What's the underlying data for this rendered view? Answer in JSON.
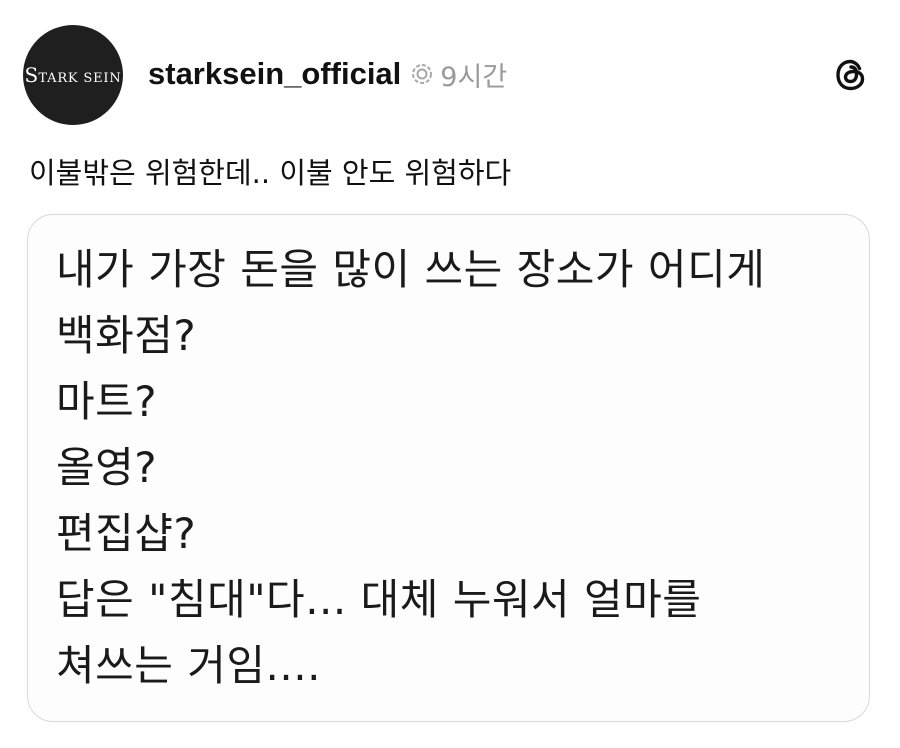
{
  "post": {
    "avatar": {
      "brand_big": "S",
      "brand_tark": "TARK",
      "brand_sein": "SEIN"
    },
    "username": "starksein_official",
    "verified_icon": "verified-badge-icon",
    "time": "9시간",
    "app_icon": "threads-logo-icon",
    "caption": "이불밖은 위험한데.. 이불 안도 위험하다",
    "image_card": {
      "lines": [
        "내가 가장 돈을 많이 쓰는 장소가 어디게",
        "백화점?",
        "마트?",
        "올영?",
        "편집샵?",
        "답은 \"침대\"다... 대체 누워서 얼마를",
        "쳐쓰는 거임...."
      ]
    }
  },
  "colors": {
    "text": "#111111",
    "muted": "#9a9a9a",
    "avatar_bg": "#1f1f1f",
    "card_border": "#d9d9d9"
  }
}
